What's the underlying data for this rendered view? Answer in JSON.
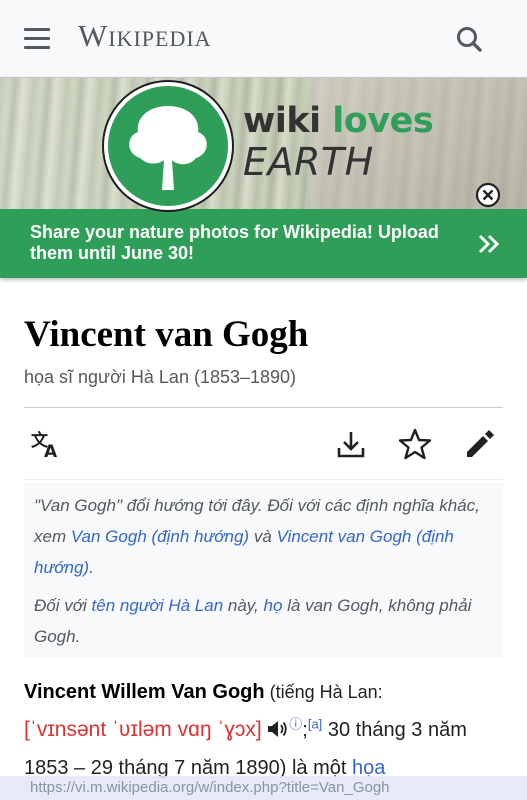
{
  "header": {
    "wordmark": "Wikipedia"
  },
  "banner": {
    "logo_word1": "wiki",
    "logo_word2": "loves",
    "logo_word3": "EARTH",
    "message": "Share your nature photos for Wikipedia! Upload them until June 30!",
    "accent_color": "#2f9e58"
  },
  "article": {
    "title": "Vincent van Gogh",
    "description": "họa sĩ người Hà Lan (1853–1890)"
  },
  "actions": {
    "icons": [
      "language-icon",
      "download-icon",
      "star-icon",
      "edit-pencil-icon"
    ]
  },
  "hatnote": {
    "p1_text1": "\"Van Gogh\" đổi hướng tới đây. Đối với các định nghĩa khác, xem ",
    "p1_link1": "Van Gogh (định hướng)",
    "p1_text2": " và ",
    "p1_link2": "Vincent van Gogh (định hướng)",
    "p1_text3": ".",
    "p2_text1": "Đối với ",
    "p2_link1": "tên người Hà Lan",
    "p2_text2": " này, ",
    "p2_link2": "họ",
    "p2_text3": " là van Gogh, không phải Gogh."
  },
  "lead": {
    "name": "Vincent Willem Van Gogh",
    "lang_prefix": " (tiếng Hà Lan:",
    "ipa": "[ˈvɪnsənt ˈʋɪləm vɑŋ ˈɣɔx]",
    "info_mark": "ⓘ",
    "semicolon": ";",
    "ref": "[a]",
    "text1": " 30 tháng 3 năm 1853 – 29 tháng 7 năm 1890) là một ",
    "link1": "họa"
  },
  "status": {
    "url": "https://vi.m.wikipedia.org/w/index.php?title=Van_Gogh"
  }
}
